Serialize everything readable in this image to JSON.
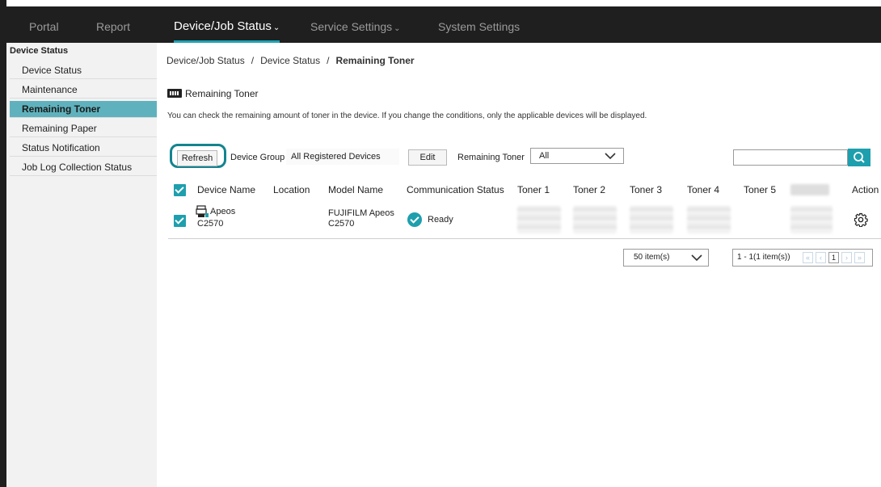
{
  "nav": {
    "items": [
      {
        "label": "Portal"
      },
      {
        "label": "Report"
      },
      {
        "label": "Device/Job Status"
      },
      {
        "label": "Service Settings"
      },
      {
        "label": "System Settings"
      }
    ],
    "active_chevron": "⌄",
    "service_chevron": "⌄"
  },
  "sidebar": {
    "heading": "Device Status",
    "items": [
      {
        "label": "Device Status"
      },
      {
        "label": "Maintenance"
      },
      {
        "label": "Remaining Toner"
      },
      {
        "label": "Remaining Paper"
      },
      {
        "label": "Status Notification"
      },
      {
        "label": "Job Log Collection Status"
      }
    ]
  },
  "breadcrumb": {
    "items": [
      "Device/Job Status",
      "Device Status",
      "Remaining Toner"
    ],
    "separator": "/"
  },
  "page": {
    "title": "Remaining Toner",
    "description": "You can check the remaining amount of toner in the device. If you change the conditions, only the applicable devices will be displayed."
  },
  "filters": {
    "refresh_label": "Refresh",
    "device_group_label": "Device Group",
    "device_group_value": "All Registered Devices",
    "edit_label": "Edit",
    "remaining_toner_label": "Remaining Toner",
    "remaining_toner_value": "All",
    "search_placeholder": ""
  },
  "table": {
    "columns": [
      "Device Name",
      "Location",
      "Model Name",
      "Communication Status",
      "Toner 1",
      "Toner 2",
      "Toner 3",
      "Toner 4",
      "Toner 5",
      "Action"
    ],
    "rows": [
      {
        "device_name_line1": "Apeos",
        "device_name_line2": "C2570",
        "location": "",
        "model_line1": "FUJIFILM Apeos",
        "model_line2": "C2570",
        "status": "Ready"
      }
    ]
  },
  "pagination": {
    "per_page": "50 item(s)",
    "range": "1 - 1(1 item(s))",
    "current_page": "1",
    "first": "«",
    "prev": "‹",
    "next": "›",
    "last": "»"
  },
  "colors": {
    "accent": "#1e9fae",
    "nav_bg": "#1f1f1f",
    "sidebar_active": "#5fb2bd",
    "highlight_ring": "#13848f"
  },
  "icons": {
    "toner": "toner-icon",
    "device": "printer-icon",
    "status_ready": "check-circle-icon",
    "action": "gear-icon",
    "search": "search-icon",
    "dropdown": "chevron-down-icon"
  }
}
